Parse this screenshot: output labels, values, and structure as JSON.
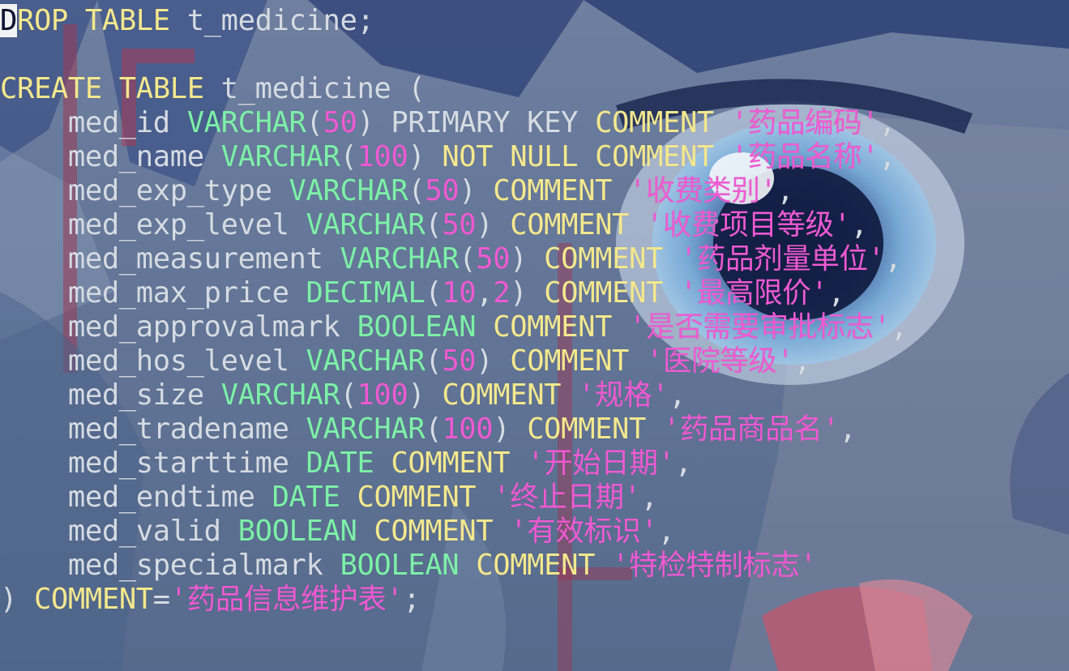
{
  "editor": {
    "lines": [
      [
        {
          "t": "D",
          "c": "cursor"
        },
        {
          "t": "ROP TABLE",
          "c": "kw"
        },
        {
          "t": " t_medicine;",
          "c": "id"
        }
      ],
      [],
      [
        {
          "t": "CREATE TABLE",
          "c": "kw"
        },
        {
          "t": " t_medicine (",
          "c": "id"
        }
      ],
      [
        {
          "t": "    med_id ",
          "c": "id"
        },
        {
          "t": "VARCHAR",
          "c": "ty"
        },
        {
          "t": "(",
          "c": "pn"
        },
        {
          "t": "50",
          "c": "num"
        },
        {
          "t": ") PRIMARY KEY ",
          "c": "pn"
        },
        {
          "t": "COMMENT",
          "c": "kw"
        },
        {
          "t": " ",
          "c": "pn"
        },
        {
          "t": "'药品编码'",
          "c": "str"
        },
        {
          "t": ",",
          "c": "pn"
        }
      ],
      [
        {
          "t": "    med_name ",
          "c": "id"
        },
        {
          "t": "VARCHAR",
          "c": "ty"
        },
        {
          "t": "(",
          "c": "pn"
        },
        {
          "t": "100",
          "c": "num"
        },
        {
          "t": ") ",
          "c": "pn"
        },
        {
          "t": "NOT NULL COMMENT",
          "c": "kw"
        },
        {
          "t": " ",
          "c": "pn"
        },
        {
          "t": "'药品名称'",
          "c": "str"
        },
        {
          "t": ",",
          "c": "pn"
        }
      ],
      [
        {
          "t": "    med_exp_type ",
          "c": "id"
        },
        {
          "t": "VARCHAR",
          "c": "ty"
        },
        {
          "t": "(",
          "c": "pn"
        },
        {
          "t": "50",
          "c": "num"
        },
        {
          "t": ") ",
          "c": "pn"
        },
        {
          "t": "COMMENT",
          "c": "kw"
        },
        {
          "t": " ",
          "c": "pn"
        },
        {
          "t": "'收费类别'",
          "c": "str"
        },
        {
          "t": ",",
          "c": "pn"
        }
      ],
      [
        {
          "t": "    med_exp_level ",
          "c": "id"
        },
        {
          "t": "VARCHAR",
          "c": "ty"
        },
        {
          "t": "(",
          "c": "pn"
        },
        {
          "t": "50",
          "c": "num"
        },
        {
          "t": ") ",
          "c": "pn"
        },
        {
          "t": "COMMENT",
          "c": "kw"
        },
        {
          "t": " ",
          "c": "pn"
        },
        {
          "t": "'收费项目等级'",
          "c": "str"
        },
        {
          "t": ",",
          "c": "pn"
        }
      ],
      [
        {
          "t": "    med_measurement ",
          "c": "id"
        },
        {
          "t": "VARCHAR",
          "c": "ty"
        },
        {
          "t": "(",
          "c": "pn"
        },
        {
          "t": "50",
          "c": "num"
        },
        {
          "t": ") ",
          "c": "pn"
        },
        {
          "t": "COMMENT",
          "c": "kw"
        },
        {
          "t": " ",
          "c": "pn"
        },
        {
          "t": "'药品剂量单位'",
          "c": "str"
        },
        {
          "t": ",",
          "c": "pn"
        }
      ],
      [
        {
          "t": "    med_max_price ",
          "c": "id"
        },
        {
          "t": "DECIMAL",
          "c": "ty"
        },
        {
          "t": "(",
          "c": "pn"
        },
        {
          "t": "10",
          "c": "num"
        },
        {
          "t": ",",
          "c": "pn"
        },
        {
          "t": "2",
          "c": "num"
        },
        {
          "t": ") ",
          "c": "pn"
        },
        {
          "t": "COMMENT",
          "c": "kw"
        },
        {
          "t": " ",
          "c": "pn"
        },
        {
          "t": "'最高限价'",
          "c": "str"
        },
        {
          "t": ",",
          "c": "pn"
        }
      ],
      [
        {
          "t": "    med_approvalmark ",
          "c": "id"
        },
        {
          "t": "BOOLEAN",
          "c": "ty"
        },
        {
          "t": " ",
          "c": "pn"
        },
        {
          "t": "COMMENT",
          "c": "kw"
        },
        {
          "t": " ",
          "c": "pn"
        },
        {
          "t": "'是否需要审批标志'",
          "c": "str"
        },
        {
          "t": ",",
          "c": "pn"
        }
      ],
      [
        {
          "t": "    med_hos_level ",
          "c": "id"
        },
        {
          "t": "VARCHAR",
          "c": "ty"
        },
        {
          "t": "(",
          "c": "pn"
        },
        {
          "t": "50",
          "c": "num"
        },
        {
          "t": ") ",
          "c": "pn"
        },
        {
          "t": "COMMENT",
          "c": "kw"
        },
        {
          "t": " ",
          "c": "pn"
        },
        {
          "t": "'医院等级'",
          "c": "str"
        },
        {
          "t": ",",
          "c": "pn"
        }
      ],
      [
        {
          "t": "    med_size ",
          "c": "id"
        },
        {
          "t": "VARCHAR",
          "c": "ty"
        },
        {
          "t": "(",
          "c": "pn"
        },
        {
          "t": "100",
          "c": "num"
        },
        {
          "t": ") ",
          "c": "pn"
        },
        {
          "t": "COMMENT",
          "c": "kw"
        },
        {
          "t": " ",
          "c": "pn"
        },
        {
          "t": "'规格'",
          "c": "str"
        },
        {
          "t": ",",
          "c": "pn"
        }
      ],
      [
        {
          "t": "    med_tradename ",
          "c": "id"
        },
        {
          "t": "VARCHAR",
          "c": "ty"
        },
        {
          "t": "(",
          "c": "pn"
        },
        {
          "t": "100",
          "c": "num"
        },
        {
          "t": ") ",
          "c": "pn"
        },
        {
          "t": "COMMENT",
          "c": "kw"
        },
        {
          "t": " ",
          "c": "pn"
        },
        {
          "t": "'药品商品名'",
          "c": "str"
        },
        {
          "t": ",",
          "c": "pn"
        }
      ],
      [
        {
          "t": "    med_starttime ",
          "c": "id"
        },
        {
          "t": "DATE",
          "c": "ty"
        },
        {
          "t": " ",
          "c": "pn"
        },
        {
          "t": "COMMENT",
          "c": "kw"
        },
        {
          "t": " ",
          "c": "pn"
        },
        {
          "t": "'开始日期'",
          "c": "str"
        },
        {
          "t": ",",
          "c": "pn"
        }
      ],
      [
        {
          "t": "    med_endtime ",
          "c": "id"
        },
        {
          "t": "DATE",
          "c": "ty"
        },
        {
          "t": " ",
          "c": "pn"
        },
        {
          "t": "COMMENT",
          "c": "kw"
        },
        {
          "t": " ",
          "c": "pn"
        },
        {
          "t": "'终止日期'",
          "c": "str"
        },
        {
          "t": ",",
          "c": "pn"
        }
      ],
      [
        {
          "t": "    med_valid ",
          "c": "id"
        },
        {
          "t": "BOOLEAN",
          "c": "ty"
        },
        {
          "t": " ",
          "c": "pn"
        },
        {
          "t": "COMMENT",
          "c": "kw"
        },
        {
          "t": " ",
          "c": "pn"
        },
        {
          "t": "'有效标识'",
          "c": "str"
        },
        {
          "t": ",",
          "c": "pn"
        }
      ],
      [
        {
          "t": "    med_specialmark ",
          "c": "id"
        },
        {
          "t": "BOOLEAN",
          "c": "ty"
        },
        {
          "t": " ",
          "c": "pn"
        },
        {
          "t": "COMMENT",
          "c": "kw"
        },
        {
          "t": " ",
          "c": "pn"
        },
        {
          "t": "'特检特制标志'",
          "c": "str"
        }
      ],
      [
        {
          "t": ") ",
          "c": "pn"
        },
        {
          "t": "COMMENT",
          "c": "kw"
        },
        {
          "t": "=",
          "c": "pn"
        },
        {
          "t": "'药品信息维护表'",
          "c": "str"
        },
        {
          "t": ";",
          "c": "pn"
        }
      ]
    ]
  }
}
